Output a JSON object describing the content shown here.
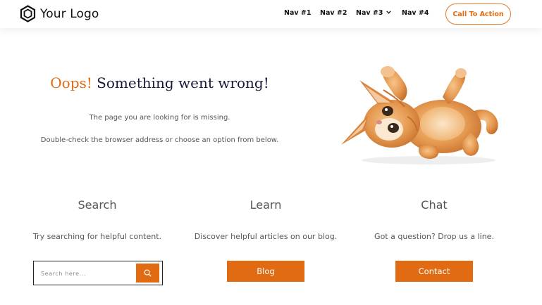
{
  "header": {
    "logo_text": "Your Logo",
    "nav": [
      {
        "label": "Nav #1"
      },
      {
        "label": "Nav #2"
      },
      {
        "label": "Nav #3"
      },
      {
        "label": "Nav #4"
      }
    ],
    "cta_label": "Call To Action"
  },
  "hero": {
    "title_accent": "Oops!",
    "title_rest": "Something went wrong!",
    "line1": "The page you are looking for is missing.",
    "line2": "Double-check the browser address or choose an option from below."
  },
  "sections": {
    "search": {
      "title": "Search",
      "description": "Try searching for helpful content.",
      "placeholder": "Search here..."
    },
    "learn": {
      "title": "Learn",
      "description": "Discover helpful articles on our blog.",
      "button_label": "Blog"
    },
    "chat": {
      "title": "Chat",
      "description": "Got a question? Drop us a line.",
      "button_label": "Contact"
    }
  },
  "icons": {
    "logo": "hexagon-logo-icon",
    "nav_dropdown": "chevron-down-icon",
    "search": "search-icon"
  },
  "colors": {
    "accent": "#e06b12",
    "title_dark": "#141a3d",
    "text": "#555555"
  }
}
